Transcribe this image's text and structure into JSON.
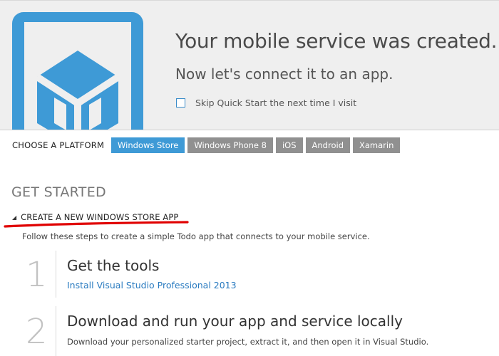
{
  "hero": {
    "title": "Your mobile service was created.",
    "subtitle": "Now let's connect it to an app.",
    "skip_label": "Skip Quick Start the next time I visit",
    "skip_checked": false,
    "icon": "mobile-cube-icon",
    "icon_color": "#3e9ad6"
  },
  "platforms": {
    "label": "CHOOSE A PLATFORM",
    "tabs": [
      {
        "label": "Windows Store",
        "active": true
      },
      {
        "label": "Windows Phone 8",
        "active": false
      },
      {
        "label": "iOS",
        "active": false
      },
      {
        "label": "Android",
        "active": false
      },
      {
        "label": "Xamarin",
        "active": false
      }
    ],
    "active_color": "#3e9ad6",
    "inactive_color": "#909090"
  },
  "get_started": {
    "heading": "GET STARTED",
    "section_title": "CREATE A NEW WINDOWS STORE APP",
    "intro": "Follow these steps to create a simple Todo app that connects to your mobile service.",
    "steps": [
      {
        "number": "1",
        "title": "Get the tools",
        "link": "Install Visual Studio Professional 2013"
      },
      {
        "number": "2",
        "title": "Download and run your app and service locally",
        "description": "Download your personalized starter project, extract it, and then open it in Visual Studio."
      }
    ]
  },
  "annotation": {
    "underline_color": "#e00000"
  }
}
